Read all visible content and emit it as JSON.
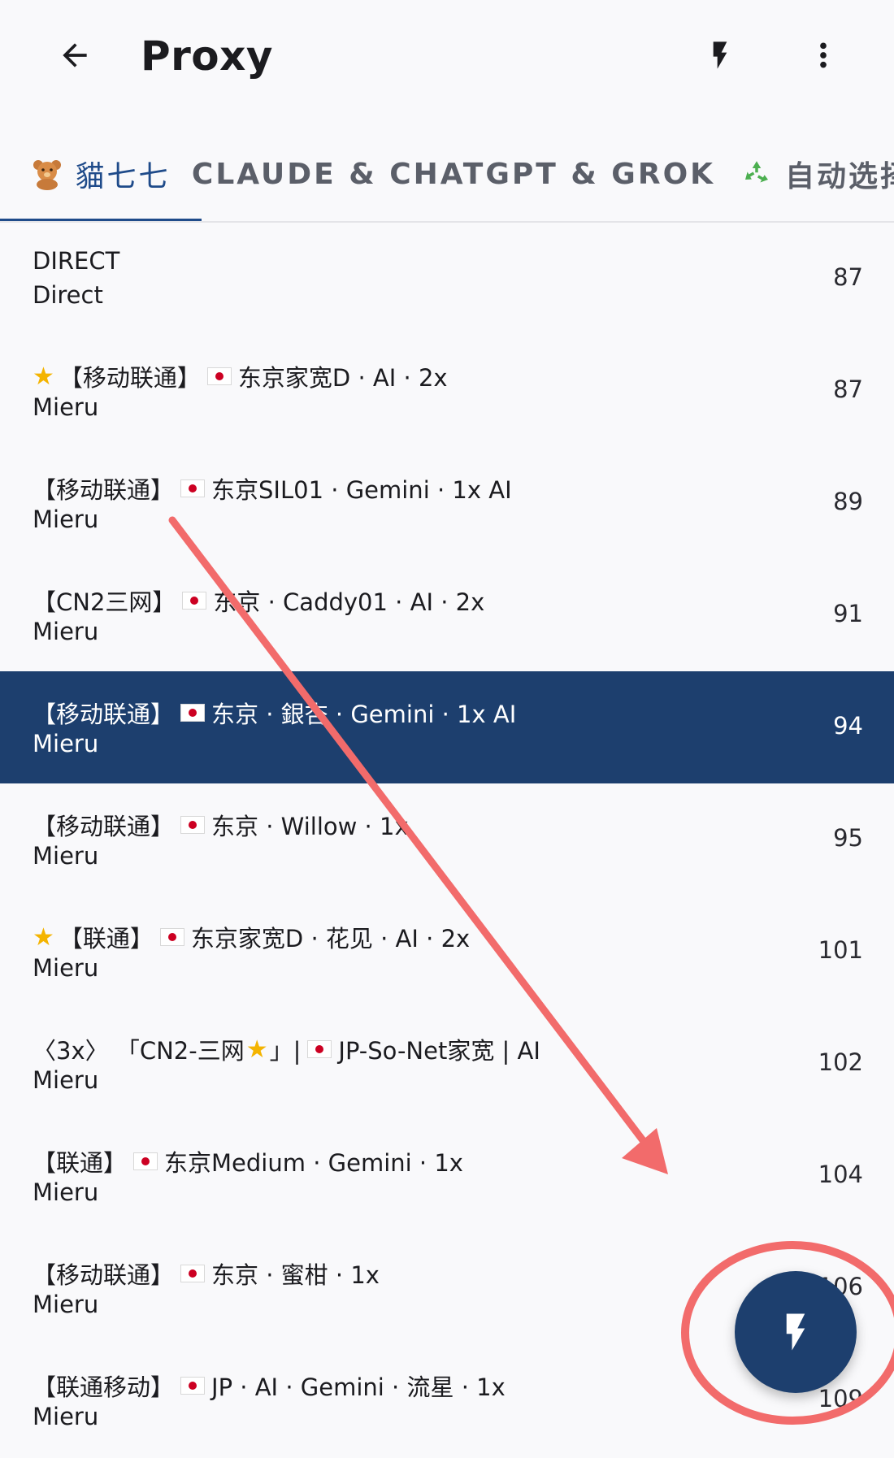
{
  "app_bar": {
    "title": "Proxy",
    "back_icon": "arrow-left-icon",
    "action_icon": "bolt-icon",
    "menu_icon": "more-vert-icon"
  },
  "tabs": [
    {
      "label": "貓七七",
      "icon": "teddy-bear-icon",
      "active": true
    },
    {
      "label": "CLAUDE & CHATGPT & GROK",
      "active": false
    },
    {
      "label": "自动选择",
      "icon": "recycle-icon",
      "active": false
    }
  ],
  "proxies": [
    {
      "name": "DIRECT",
      "protocol": "Direct",
      "latency": "87"
    },
    {
      "name_prefix": "",
      "name_tag": "【移动联通】",
      "name_rest": "东京家宽D · AI · 2x",
      "star": true,
      "flag": true,
      "protocol": "Mieru",
      "latency": "87"
    },
    {
      "name_tag": "【移动联通】",
      "name_rest": "东京SIL01 · Gemini · 1x AI",
      "flag": true,
      "protocol": "Mieru",
      "latency": "89"
    },
    {
      "name_tag": "【CN2三网】",
      "name_rest": "东京 · Caddy01 · AI · 2x",
      "flag": true,
      "protocol": "Mieru",
      "latency": "91"
    },
    {
      "name_tag": "【移动联通】",
      "name_rest": "东京 · 銀杏 · Gemini · 1x AI",
      "flag": true,
      "protocol": "Mieru",
      "latency": "94",
      "selected": true
    },
    {
      "name_tag": "【移动联通】",
      "name_rest": "东京 · Willow · 1x",
      "flag": true,
      "protocol": "Mieru",
      "latency": "95"
    },
    {
      "name_tag": "【联通】",
      "name_rest": "东京家宽D · 花见 · AI · 2x",
      "star": true,
      "flag": true,
      "protocol": "Mieru",
      "latency": "101"
    },
    {
      "name_tag": "〈3x〉 「CN2-三网",
      "name_mid": "」|",
      "name_rest": "JP-So-Net家宽 | AI",
      "inline_star": true,
      "flag": true,
      "protocol": "Mieru",
      "latency": "102"
    },
    {
      "name_tag": "【联通】",
      "name_rest": "东京Medium · Gemini · 1x",
      "flag": true,
      "protocol": "Mieru",
      "latency": "104"
    },
    {
      "name_tag": "【移动联通】",
      "name_rest": "东京 · 蜜柑 · 1x",
      "flag": true,
      "protocol": "Mieru",
      "latency": "106"
    },
    {
      "name_tag": "【联通移动】",
      "name_rest": "JP · AI · Gemini · 流星 · 1x",
      "flag": true,
      "protocol": "Mieru",
      "latency": "109"
    }
  ],
  "fab": {
    "icon": "bolt-icon"
  },
  "annotation": {
    "arrow_color": "#f26b6b",
    "circle_color": "#f26b6b"
  },
  "colors": {
    "accent": "#1f4b8a",
    "selected_bg": "#1d3f6e"
  }
}
